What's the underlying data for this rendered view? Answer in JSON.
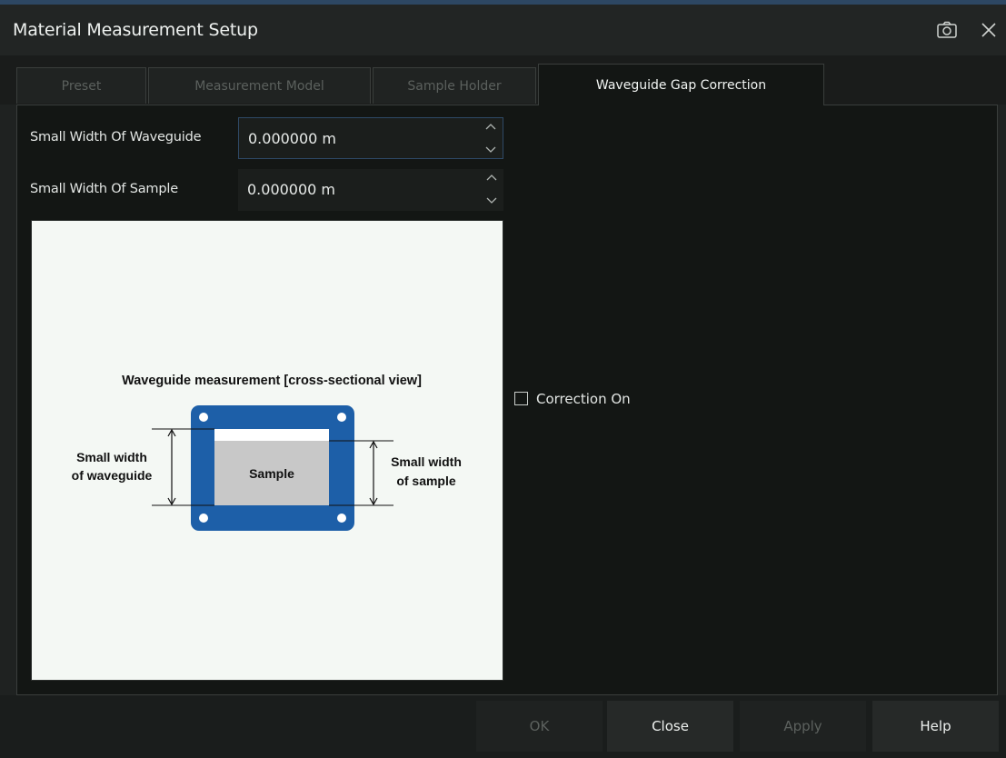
{
  "window": {
    "title": "Material Measurement Setup"
  },
  "tabs": [
    {
      "label": "Preset",
      "active": false
    },
    {
      "label": "Measurement Model",
      "active": false
    },
    {
      "label": "Sample Holder",
      "active": false
    },
    {
      "label": "Waveguide Gap Correction",
      "active": true
    }
  ],
  "fields": {
    "waveguide": {
      "label": "Small Width Of Waveguide",
      "value": "0.000000 m"
    },
    "sample": {
      "label": "Small Width Of Sample",
      "value": "0.000000 m"
    }
  },
  "figure": {
    "title": "Waveguide measurement [cross-sectional view]",
    "left_label_1": "Small width",
    "left_label_2": "of waveguide",
    "right_label_1": "Small width",
    "right_label_2": "of sample",
    "sample_label": "Sample"
  },
  "correction": {
    "label": "Correction On",
    "checked": false
  },
  "buttons": {
    "ok": "OK",
    "close": "Close",
    "apply": "Apply",
    "help": "Help"
  },
  "icons": {
    "screenshot": "camera-icon",
    "close": "close-icon"
  },
  "colors": {
    "accent": "#2e4966",
    "waveguide_frame": "#1d5fa8",
    "sample_fill": "#c8c8c8"
  }
}
